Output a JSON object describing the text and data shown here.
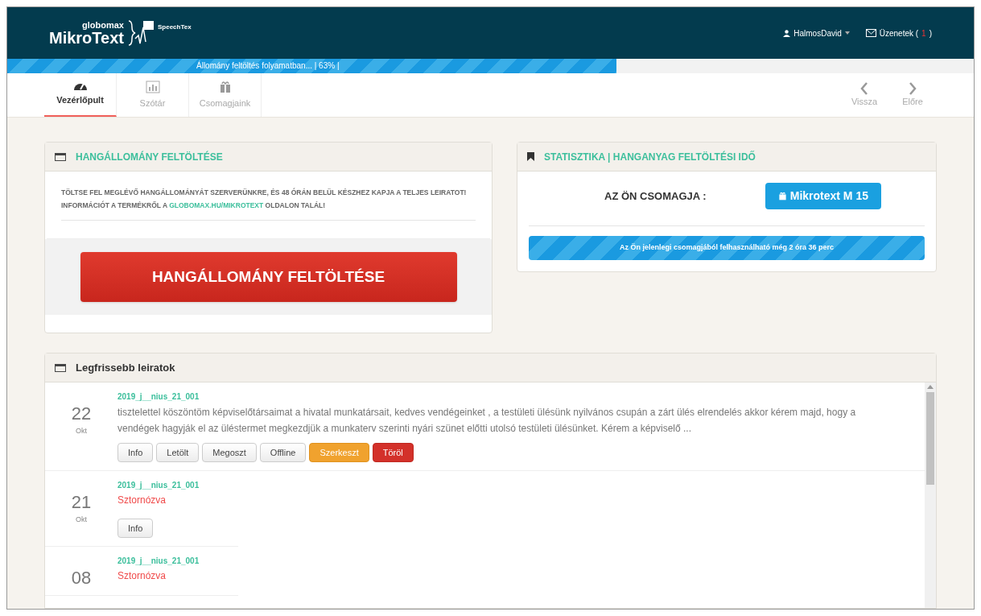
{
  "header": {
    "logo": {
      "brand_small": "globomax",
      "brand": "MikroText",
      "product": "SpeechTex"
    },
    "user": "HalmosDavid",
    "messages": {
      "label": "Üzenetek (",
      "count": "1",
      "close": ")"
    }
  },
  "upload_progress": {
    "text": "Állomány feltöltés folyamatban... | 63% |",
    "level": 0.63
  },
  "tabs": [
    {
      "label": "Vezérlőpult",
      "kind": "dashboard",
      "selected": true
    },
    {
      "label": "Szótár",
      "kind": "chart",
      "selected": false
    },
    {
      "label": "Csomagjaink",
      "kind": "gift",
      "selected": false
    }
  ],
  "nav": {
    "back": "Vissza",
    "forward": "Előre"
  },
  "upload_panel": {
    "title": "HANGÁLLOMÁNY FELTÖLTÉSE",
    "text": "TÖLTSE FEL MEGLÉVŐ HANGÁLLOMÁNYÁT SZERVERÜNKRE, ÉS 48 ÓRÁN BELÜL KÉSZHEZ KAPJA A TELJES LEIRATOT! INFORMÁCIÓT A TERMÉKRŐL A",
    "link": "GLOBOMAX.HU/MIKROTEXT",
    "text_after": "OLDALON TALÁL!",
    "button": "HANGÁLLOMÁNY FELTÖLTÉSE"
  },
  "stats_panel": {
    "title": "STATISZTIKA | HANGANYAG FELTÖLTÉSI IDŐ",
    "package_label": "AZ ÖN CSOMAGJA :",
    "package": "Mikrotext M 15",
    "remaining": {
      "text": "Az Ön jelenlegi csomagjából felhasználható még 2 óra 36 perc"
    }
  },
  "recent": {
    "title": "Legfrissebb leiratok",
    "items": [
      {
        "day": "22",
        "month": "Okt",
        "name": "2019_j__nius_21_001",
        "kind": "text",
        "text": "tisztelettel köszöntöm képviselőtársaimat a hivatal munkatársait, kedves vendégeinket , a testületi ülésünk nyilvános csupán a zárt ülés elrendelés akkor kérem majd, hogy a vendégek hagyják el az üléstermet megkezdjük a munkaterv szerinti nyári szünet előtti utolsó testületi ülésünket. Kérem a képviselő ...",
        "buttons": [
          {
            "label": "Info",
            "kind": "default"
          },
          {
            "label": "Letölt",
            "kind": "default"
          },
          {
            "label": "Megoszt",
            "kind": "default"
          },
          {
            "label": "Offline",
            "kind": "default"
          },
          {
            "label": "Szerkeszt",
            "kind": "warning"
          },
          {
            "label": "Töröl",
            "kind": "danger"
          }
        ]
      },
      {
        "day": "21",
        "month": "Okt",
        "name": "2019_j__nius_21_001",
        "kind": "cancelled",
        "text": "Sztornózva",
        "buttons": [
          {
            "label": "Info",
            "kind": "default"
          }
        ]
      },
      {
        "day": "08",
        "name": "2019_j__nius_21_001",
        "kind": "cancelled",
        "text": "Sztornózva"
      }
    ]
  }
}
